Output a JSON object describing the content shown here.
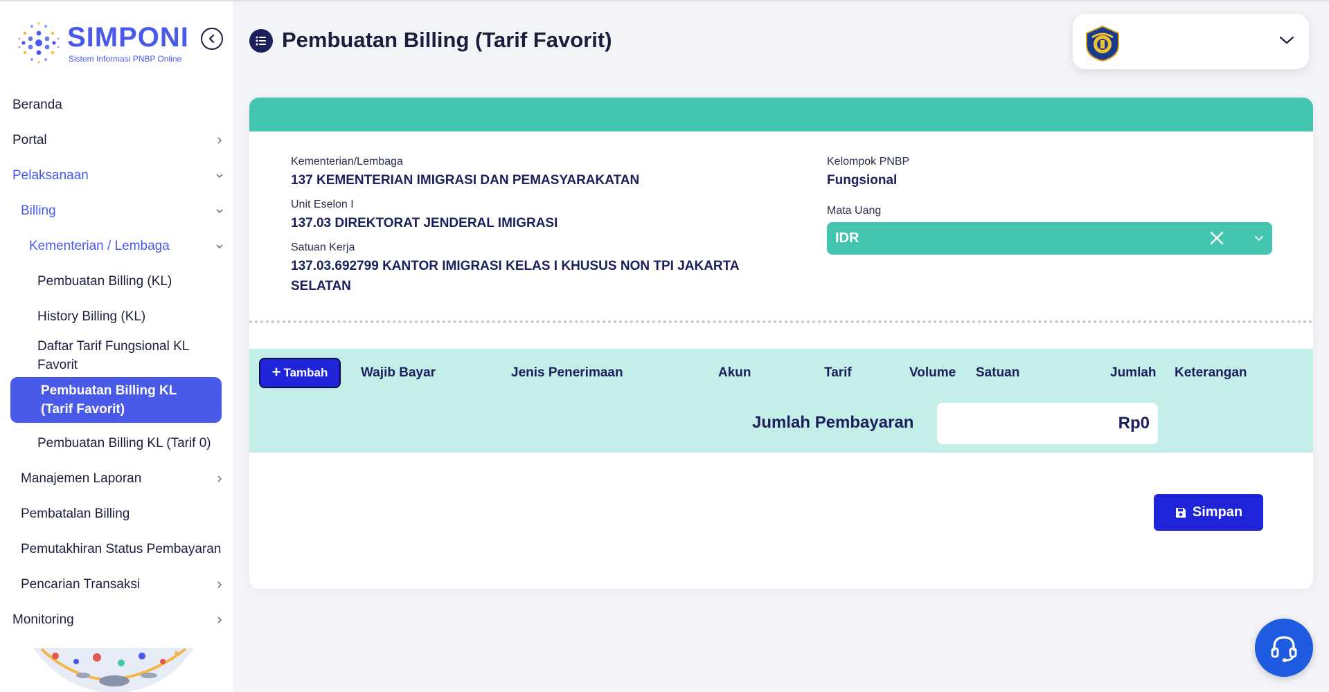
{
  "app": {
    "name": "SIMPONI",
    "tagline": "Sistem Informasi PNBP Online"
  },
  "sidebar": {
    "items": [
      {
        "label": "Beranda"
      },
      {
        "label": "Portal"
      },
      {
        "label": "Pelaksanaan"
      },
      {
        "label": "Billing"
      },
      {
        "label": "Kementerian / Lembaga"
      },
      {
        "label": "Pembuatan Billing (KL)"
      },
      {
        "label": "History Billing (KL)"
      },
      {
        "label": "Daftar Tarif Fungsional KL Favorit"
      },
      {
        "label": "Pembuatan Billing KL (Tarif Favorit)"
      },
      {
        "label": "Pembuatan Billing KL (Tarif 0)"
      },
      {
        "label": "Manajemen Laporan"
      },
      {
        "label": "Pembatalan Billing"
      },
      {
        "label": "Pemutakhiran Status Pembayaran"
      },
      {
        "label": "Pencarian Transaksi"
      },
      {
        "label": "Monitoring"
      }
    ]
  },
  "header": {
    "title": "Pembuatan Billing (Tarif Favorit)"
  },
  "form": {
    "kementerian_label": "Kementerian/Lembaga",
    "kementerian_value": "137 KEMENTERIAN IMIGRASI DAN PEMASYARAKATAN",
    "eselon_label": "Unit Eselon I",
    "eselon_value": "137.03 DIREKTORAT JENDERAL IMIGRASI",
    "satker_label": "Satuan Kerja",
    "satker_value": "137.03.692799 KANTOR IMIGRASI KELAS I KHUSUS NON TPI JAKARTA SELATAN",
    "kelompok_label": "Kelompok PNBP",
    "kelompok_value": "Fungsional",
    "mata_uang_label": "Mata Uang",
    "mata_uang_value": "IDR"
  },
  "table": {
    "add_label": "Tambah",
    "columns": [
      "Wajib Bayar",
      "Jenis Penerimaan",
      "Akun",
      "Tarif",
      "Volume",
      "Satuan",
      "Jumlah",
      "Keterangan"
    ],
    "total_label": "Jumlah Pembayaran",
    "total_value": "Rp0"
  },
  "actions": {
    "save_label": "Simpan"
  },
  "colors": {
    "accent": "#4a5ae8",
    "teal": "#43c5b0",
    "band": "#c4eee8",
    "primary_button": "#1f24d8",
    "text_dark": "#1b1f5b"
  }
}
